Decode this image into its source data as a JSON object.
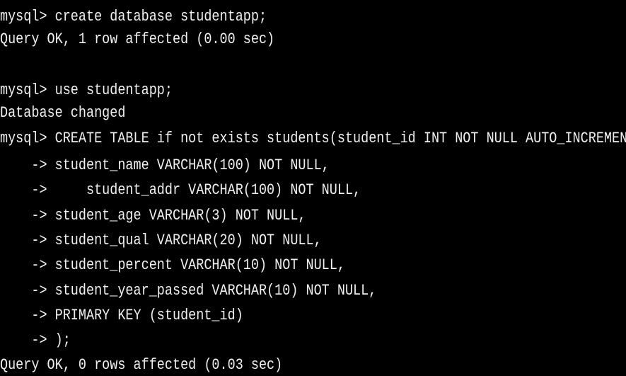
{
  "terminal": {
    "lines": [
      "mysql> create database studentapp;",
      "Query OK, 1 row affected (0.00 sec)",
      "",
      "mysql> use studentapp;",
      "Database changed",
      "mysql> CREATE TABLE if not exists students(student_id INT NOT NULL AUTO_INCREMENT,",
      "    -> student_name VARCHAR(100) NOT NULL,",
      "    ->     student_addr VARCHAR(100) NOT NULL,",
      "    -> student_age VARCHAR(3) NOT NULL,",
      "    -> student_qual VARCHAR(20) NOT NULL,",
      "    -> student_percent VARCHAR(10) NOT NULL,",
      "    -> student_year_passed VARCHAR(10) NOT NULL,",
      "    -> PRIMARY KEY (student_id)",
      "    -> );",
      "Query OK, 0 rows affected (0.03 sec)"
    ]
  }
}
